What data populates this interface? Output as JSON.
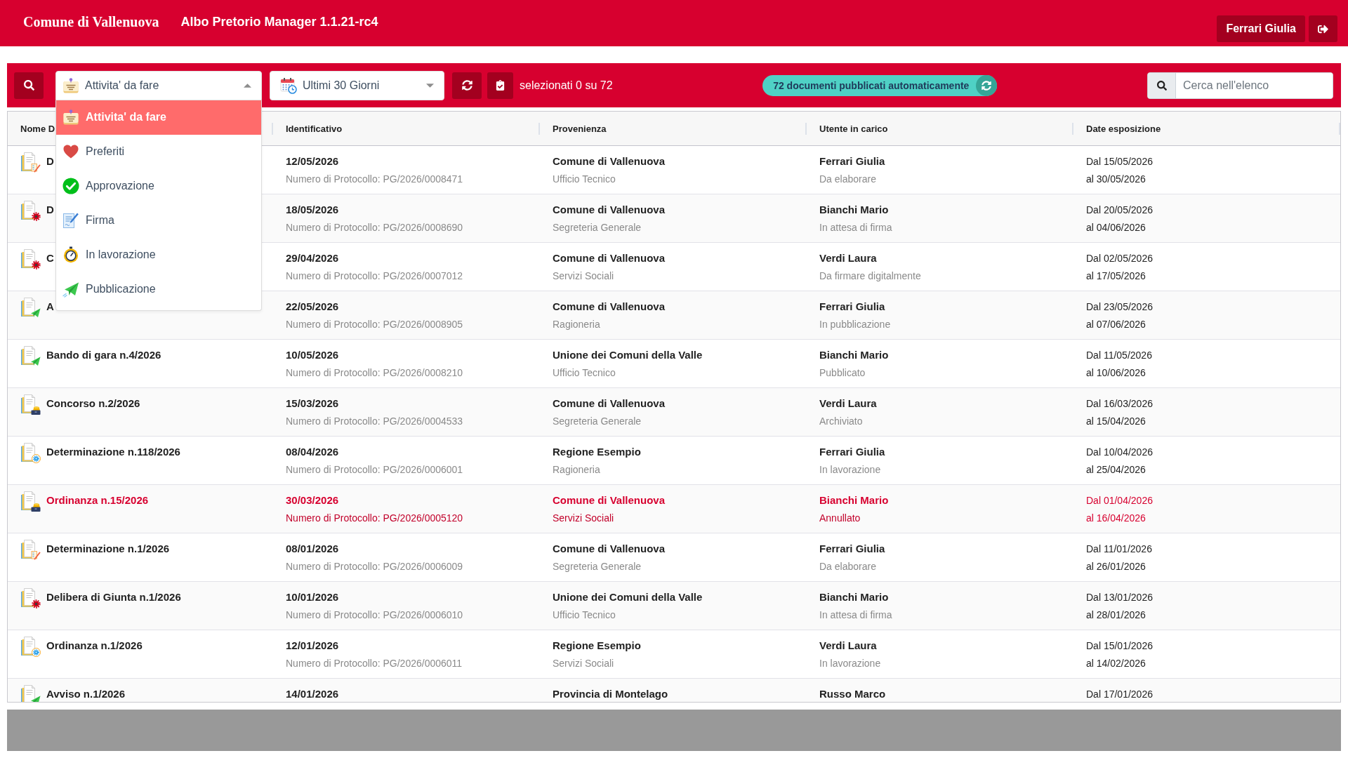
{
  "header": {
    "title": "Comune di Vallenuova",
    "app_name": "Albo Pretorio Manager 1.1.21-rc4",
    "user": "Ferrari Giulia"
  },
  "toolbar": {
    "activity_filter": {
      "value": "Attivita' da fare",
      "kind": "todo",
      "expanded": true,
      "options": [
        {
          "label": "Attivita' da fare",
          "kind": "todo",
          "selected": true
        },
        {
          "label": "Preferiti",
          "kind": "favorite",
          "selected": false
        },
        {
          "label": "Approvazione",
          "kind": "approval",
          "selected": false
        },
        {
          "label": "Firma",
          "kind": "signature",
          "selected": false
        },
        {
          "label": "In lavorazione",
          "kind": "in_progress",
          "selected": false
        },
        {
          "label": "Pubblicazione",
          "kind": "publication",
          "selected": false
        }
      ]
    },
    "period_filter": {
      "value": "Ultimi 30 Giorni",
      "expanded": false
    },
    "selection_count": "selezionati 0 su 72",
    "auto_publish": "72 documenti pubblicati automaticamente",
    "search": {
      "placeholder": "Cerca nell'elenco"
    }
  },
  "table": {
    "columns": [
      "Nome D",
      "Identificativo",
      "Provenienza",
      "Utente in carico",
      "Date esposizione"
    ],
    "rows": [
      {
        "kind": "draft",
        "highlighted": false,
        "name": "D",
        "date": "12/05/2026",
        "protocol": "Numero di Protocollo: PG/2026/0008471",
        "origin": "Comune di Vallenuova",
        "office": "Ufficio Tecnico",
        "user": "Ferrari Giulia",
        "status": "Da elaborare",
        "from": "Dal 15/05/2026",
        "to": "al 30/05/2026"
      },
      {
        "kind": "signing",
        "highlighted": false,
        "name": "D",
        "date": "18/05/2026",
        "protocol": "Numero di Protocollo: PG/2026/0008690",
        "origin": "Comune di Vallenuova",
        "office": "Segreteria Generale",
        "user": "Bianchi Mario",
        "status": "In attesa di firma",
        "from": "Dal 20/05/2026",
        "to": "al 04/06/2026"
      },
      {
        "kind": "signing",
        "highlighted": false,
        "name": "C",
        "date": "29/04/2026",
        "protocol": "Numero di Protocollo: PG/2026/0007012",
        "origin": "Comune di Vallenuova",
        "office": "Servizi Sociali",
        "user": "Verdi Laura",
        "status": "Da firmare digitalmente",
        "from": "Dal 02/05/2026",
        "to": "al 17/05/2026"
      },
      {
        "kind": "publishing",
        "highlighted": false,
        "name": "A",
        "date": "22/05/2026",
        "protocol": "Numero di Protocollo: PG/2026/0008905",
        "origin": "Comune di Vallenuova",
        "office": "Ragioneria",
        "user": "Ferrari Giulia",
        "status": "In pubblicazione",
        "from": "Dal 23/05/2026",
        "to": "al 07/06/2026"
      },
      {
        "kind": "publishing",
        "highlighted": false,
        "name": "Bando di gara n.4/2026",
        "date": "10/05/2026",
        "protocol": "Numero di Protocollo: PG/2026/0008210",
        "origin": "Unione dei Comuni della Valle",
        "office": "Ufficio Tecnico",
        "user": "Bianchi Mario",
        "status": "Pubblicato",
        "from": "Dal 11/05/2026",
        "to": "al 10/06/2026"
      },
      {
        "kind": "archived",
        "highlighted": false,
        "name": "Concorso n.2/2026",
        "date": "15/03/2026",
        "protocol": "Numero di Protocollo: PG/2026/0004533",
        "origin": "Comune di Vallenuova",
        "office": "Segreteria Generale",
        "user": "Verdi Laura",
        "status": "Archiviato",
        "from": "Dal 16/03/2026",
        "to": "al 15/04/2026"
      },
      {
        "kind": "processing",
        "highlighted": false,
        "name": "Determinazione n.118/2026",
        "date": "08/04/2026",
        "protocol": "Numero di Protocollo: PG/2026/0006001",
        "origin": "Regione Esempio",
        "office": "Ragioneria",
        "user": "Ferrari Giulia",
        "status": "In lavorazione",
        "from": "Dal 10/04/2026",
        "to": "al 25/04/2026"
      },
      {
        "kind": "archived",
        "highlighted": true,
        "name": "Ordinanza n.15/2026",
        "date": "30/03/2026",
        "protocol": "Numero di Protocollo: PG/2026/0005120",
        "origin": "Comune di Vallenuova",
        "office": "Servizi Sociali",
        "user": "Bianchi Mario",
        "status": "Annullato",
        "from": "Dal 01/04/2026",
        "to": "al 16/04/2026"
      },
      {
        "kind": "draft",
        "highlighted": false,
        "name": "Determinazione n.1/2026",
        "date": "08/01/2026",
        "protocol": "Numero di Protocollo: PG/2026/0006009",
        "origin": "Comune di Vallenuova",
        "office": "Segreteria Generale",
        "user": "Ferrari Giulia",
        "status": "Da elaborare",
        "from": "Dal 11/01/2026",
        "to": "al 26/01/2026"
      },
      {
        "kind": "signing",
        "highlighted": false,
        "name": "Delibera di Giunta n.1/2026",
        "date": "10/01/2026",
        "protocol": "Numero di Protocollo: PG/2026/0006010",
        "origin": "Unione dei Comuni della Valle",
        "office": "Ufficio Tecnico",
        "user": "Bianchi Mario",
        "status": "In attesa di firma",
        "from": "Dal 13/01/2026",
        "to": "al 28/01/2026"
      },
      {
        "kind": "processing",
        "highlighted": false,
        "name": "Ordinanza n.1/2026",
        "date": "12/01/2026",
        "protocol": "Numero di Protocollo: PG/2026/0006011",
        "origin": "Regione Esempio",
        "office": "Servizi Sociali",
        "user": "Verdi Laura",
        "status": "In lavorazione",
        "from": "Dal 15/01/2026",
        "to": "al 14/02/2026"
      },
      {
        "kind": "publishing",
        "highlighted": false,
        "name": "Avviso n.1/2026",
        "date": "14/01/2026",
        "origin": "Provincia di Montelago",
        "user": "Russo Marco",
        "from": "Dal 17/01/2026"
      }
    ]
  }
}
